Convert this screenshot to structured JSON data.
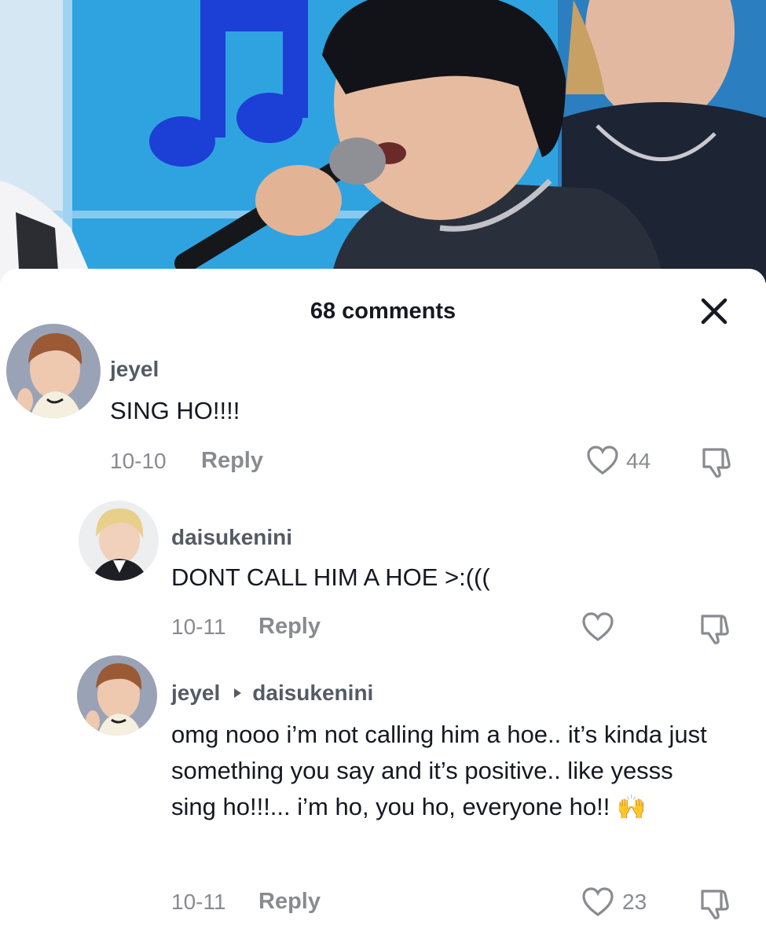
{
  "sheet": {
    "title": "68 comments"
  },
  "comments": [
    {
      "username": "jeyel",
      "text": "SING HO!!!!",
      "date": "10-10",
      "reply": "Reply",
      "likes": "44"
    },
    {
      "username": "daisukenini",
      "text": "DONT CALL HIM A HOE >:(((",
      "date": "10-11",
      "reply": "Reply",
      "likes": ""
    },
    {
      "username": "jeyel",
      "reply_to": "daisukenini",
      "text": "omg nooo i’m not calling him a hoe.. it’s kinda just something you say and it’s positive.. like yesss sing ho!!!... i’m ho, you ho, everyone ho!!",
      "emoji": "🙌",
      "date": "10-11",
      "reply": "Reply",
      "likes": "23"
    }
  ],
  "icons": {
    "close": "close-icon",
    "like": "heart-icon",
    "dislike": "dislike-icon"
  },
  "colors": {
    "video_bg": "#2fa3e0",
    "note": "#1c3fd6",
    "muted": "#8a8b91"
  }
}
